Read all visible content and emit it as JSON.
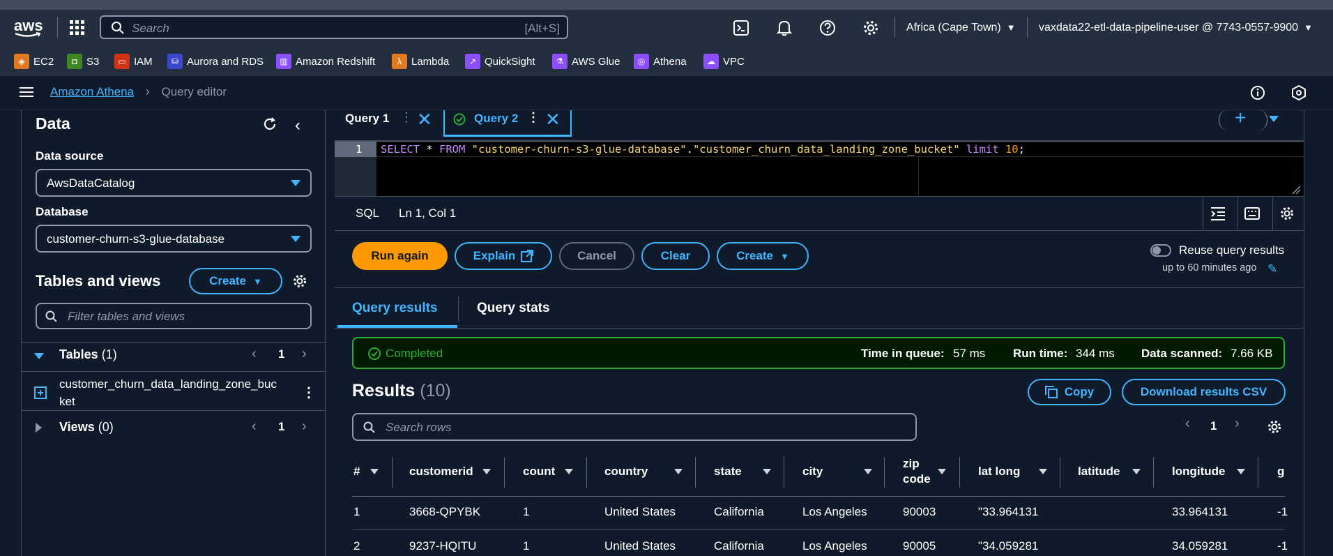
{
  "topnav": {
    "logo": "aws",
    "search_placeholder": "Search",
    "search_shortcut": "[Alt+S]",
    "region": "Africa (Cape Town)",
    "account": "vaxdata22-etl-data-pipeline-user @ 7743-0557-9900"
  },
  "favorites": [
    {
      "label": "EC2",
      "color": "#e07b21"
    },
    {
      "label": "S3",
      "color": "#3f8624"
    },
    {
      "label": "IAM",
      "color": "#d13212"
    },
    {
      "label": "Aurora and RDS",
      "color": "#3b48cc"
    },
    {
      "label": "Amazon Redshift",
      "color": "#8c4fff"
    },
    {
      "label": "Lambda",
      "color": "#e07b21"
    },
    {
      "label": "QuickSight",
      "color": "#8c4fff"
    },
    {
      "label": "AWS Glue",
      "color": "#8c4fff"
    },
    {
      "label": "Athena",
      "color": "#8c4fff"
    },
    {
      "label": "VPC",
      "color": "#8c4fff"
    }
  ],
  "breadcrumb": {
    "service": "Amazon Athena",
    "page": "Query editor"
  },
  "left": {
    "title": "Data",
    "data_source_label": "Data source",
    "data_source_value": "AwsDataCatalog",
    "database_label": "Database",
    "database_value": "customer-churn-s3-glue-database",
    "tables_views_title": "Tables and views",
    "create_label": "Create",
    "filter_placeholder": "Filter tables and views",
    "tables_label": "Tables",
    "tables_count": "(1)",
    "tables_page": "1",
    "table_name_line1": "customer_churn_data_landing_zone_buc",
    "table_name_line2": "ket",
    "views_label": "Views",
    "views_count": "(0)",
    "views_page": "1"
  },
  "tabs": [
    {
      "label": "Query 1"
    },
    {
      "label": "Query 2"
    }
  ],
  "editor": {
    "line_number": "1",
    "sql_keyword1": "SELECT",
    "sql_star": " * ",
    "sql_keyword2": "FROM",
    "sql_db": "\"customer-churn-s3-glue-database\"",
    "sql_dot": ".",
    "sql_table": "\"customer_churn_data_landing_zone_bucket\"",
    "sql_limit": "limit",
    "sql_num": "10",
    "sql_semi": ";",
    "lang": "SQL",
    "position": "Ln 1, Col 1"
  },
  "actions": {
    "run_again": "Run again",
    "explain": "Explain",
    "cancel": "Cancel",
    "clear": "Clear",
    "create": "Create",
    "reuse_label": "Reuse query results",
    "reuse_sub": "up to 60 minutes ago"
  },
  "result_tabs": {
    "results": "Query results",
    "stats": "Query stats"
  },
  "status": {
    "state": "Completed",
    "queue_label": "Time in queue:",
    "queue_value": "57 ms",
    "run_label": "Run time:",
    "run_value": "344 ms",
    "scanned_label": "Data scanned:",
    "scanned_value": "7.66 KB"
  },
  "results": {
    "title": "Results",
    "count": "(10)",
    "copy": "Copy",
    "download": "Download results CSV",
    "search_placeholder": "Search rows",
    "page": "1",
    "columns": [
      "#",
      "customerid",
      "count",
      "country",
      "state",
      "city",
      "zip",
      "code",
      "lat long",
      "latitude",
      "longitude",
      "g"
    ],
    "rows": [
      [
        "1",
        "3668-QPYBK",
        "1",
        "United States",
        "California",
        "Los Angeles",
        "90003",
        "\"33.964131",
        "",
        "33.964131",
        "-1"
      ],
      [
        "2",
        "9237-HQITU",
        "1",
        "United States",
        "California",
        "Los Angeles",
        "90005",
        "\"34.059281",
        "",
        "34.059281",
        "-1"
      ]
    ]
  }
}
